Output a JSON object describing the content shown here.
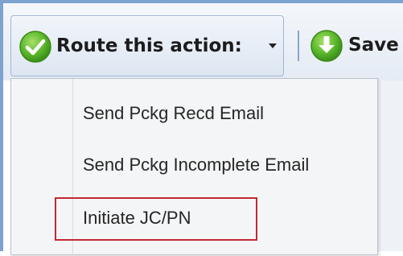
{
  "toolbar": {
    "route_label": "Route this action:",
    "save_label": "Save"
  },
  "icons": {
    "route": "check-circle-icon",
    "save": "download-circle-icon",
    "dropdown": "caret-down-icon"
  },
  "dropdown": {
    "items": [
      {
        "label": "Send Pckg Recd Email"
      },
      {
        "label": "Send Pckg Incomplete Email"
      },
      {
        "label": "Initiate JC/PN"
      }
    ],
    "highlighted_index": 2
  },
  "colors": {
    "frame": "#7fa3cf",
    "check_green": "#5cb82c",
    "highlight_border": "#c3282f",
    "menu_background": "#f4f5f6"
  }
}
